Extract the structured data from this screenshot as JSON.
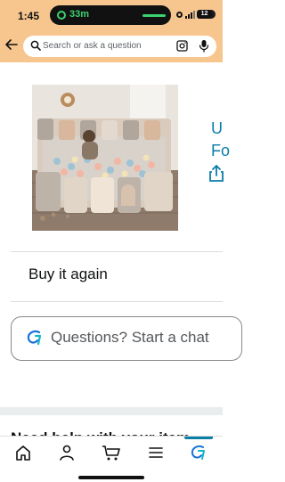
{
  "status_bar": {
    "time": "1:45",
    "call_duration": "33m",
    "battery": "12"
  },
  "search": {
    "placeholder": "Search or ask a question"
  },
  "product": {
    "title_peek": "U\nFo"
  },
  "buy_again": {
    "label": "Buy it again"
  },
  "ask": {
    "label": "Questions? Start a chat"
  },
  "next_section": {
    "heading": "Need help with your item"
  },
  "nav": {
    "items": [
      "home",
      "account",
      "cart",
      "menu",
      "rufus"
    ],
    "selected": "rufus"
  },
  "colors": {
    "header_bg": "#f6c68e",
    "accent": "#0b7ea8",
    "call_green": "#3bd16f"
  }
}
